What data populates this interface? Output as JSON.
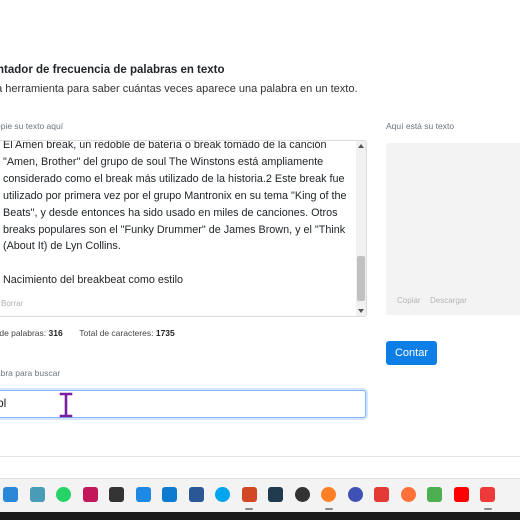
{
  "header": {
    "title": "ontador de frecuencia de palabras en texto",
    "subtitle": "na herramienta para saber cuántas veces aparece una palabra en un texto."
  },
  "input_section": {
    "label": "epie su texto aquí",
    "paragraphs": [
      "El Amen break, un redoble de batería o break tomado de la canción \"Amen, Brother\" del grupo de soul The Winstons está ampliamente considerado como el break más utilizado de la historia.2 Este break fue utilizado por primera vez por el grupo Mantronix en su tema \"King of the Beats\", y desde entonces ha sido usado en miles de canciones. Otros breaks populares son el \"Funky Drummer\" de James Brown, y el \"Think (About It) de Lyn Collins.",
      "Nacimiento del breakbeat como estilo"
    ],
    "clear_label": "Borrar"
  },
  "output_section": {
    "label": "Aquí está su texto",
    "copy_label": "Copiar",
    "download_label": "Descargar"
  },
  "stats": {
    "words_label": "tal de palabras:",
    "words_value": "316",
    "chars_label": "Total de caracteres:",
    "chars_value": "1735"
  },
  "count_button": {
    "label": "Contar"
  },
  "search": {
    "label": "labra para buscar",
    "value": "bl"
  },
  "taskbar": {
    "icons": [
      {
        "name": "store-icon",
        "color": "#2b88d8",
        "active": false
      },
      {
        "name": "terminal-icon",
        "color": "#4a9bb5",
        "active": false
      },
      {
        "name": "whatsapp-icon",
        "color": "#25d366",
        "active": false
      },
      {
        "name": "snipping-tool-icon",
        "color": "#c2185b",
        "active": false
      },
      {
        "name": "usb-icon",
        "color": "#333333",
        "active": false
      },
      {
        "name": "pen-tool-icon",
        "color": "#1e88e5",
        "active": false
      },
      {
        "name": "edge-dev-icon",
        "color": "#0f7bd0",
        "active": false
      },
      {
        "name": "meet-icon",
        "color": "#2b5797",
        "active": false
      },
      {
        "name": "cloud-app-icon",
        "color": "#00a4ef",
        "active": false
      },
      {
        "name": "powerpoint-icon",
        "color": "#d24726",
        "active": true
      },
      {
        "name": "video-editor-icon",
        "color": "#1f3b4d",
        "active": false
      },
      {
        "name": "record-app-icon",
        "color": "#333333",
        "active": false
      },
      {
        "name": "media-player-icon",
        "color": "#ff7f27",
        "active": true
      },
      {
        "name": "vivaldi-blue-icon",
        "color": "#3f51b5",
        "active": false
      },
      {
        "name": "opera-icon",
        "color": "#e53935",
        "active": false
      },
      {
        "name": "firefox-icon",
        "color": "#ff7139",
        "active": false
      },
      {
        "name": "bluestacks-icon",
        "color": "#4caf50",
        "active": false
      },
      {
        "name": "youtube-icon",
        "color": "#ff0000",
        "active": false
      },
      {
        "name": "vivaldi-icon",
        "color": "#ef3939",
        "active": true
      }
    ]
  },
  "colors": {
    "primary": "#0d7ee6",
    "focus_border": "#86b7fe",
    "cursor": "#7b1fa2"
  }
}
